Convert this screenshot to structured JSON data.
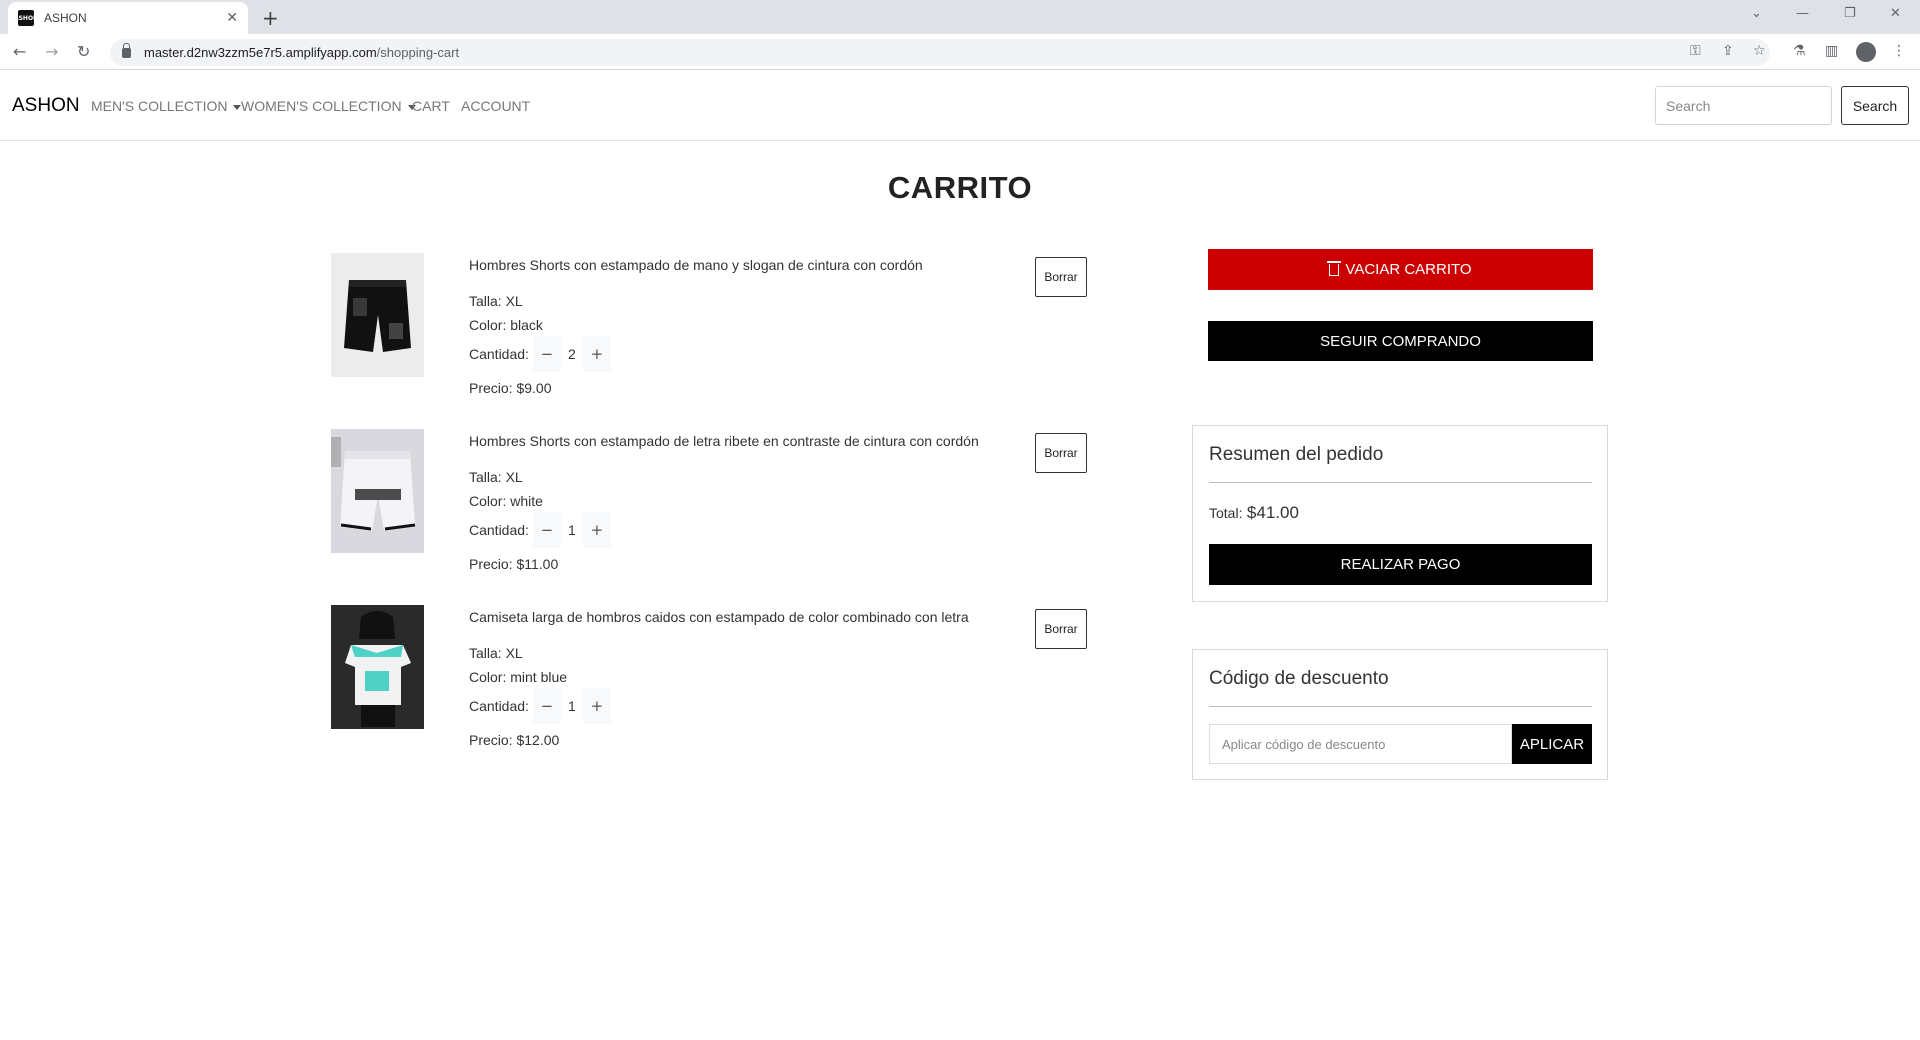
{
  "browser": {
    "tab_title": "ASHON",
    "favicon_text": "ASHON",
    "url_host": "master.d2nw3zzm5e7r5.amplifyapp.com",
    "url_path": "/shopping-cart"
  },
  "navbar": {
    "brand": "ASHON",
    "links": [
      "MEN'S COLLECTION",
      "WOMEN'S COLLECTION",
      "CART",
      "ACCOUNT"
    ],
    "search_placeholder": "Search",
    "search_button": "Search"
  },
  "page": {
    "title": "CARRITO"
  },
  "cart": {
    "delete_label": "Borrar",
    "qty_label": "Cantidad:",
    "items": [
      {
        "name": "Hombres Shorts con estampado de mano y slogan de cintura con cordón",
        "size": "Talla: XL",
        "color": "Color: black",
        "qty": "2",
        "price": "Precio: $9.00"
      },
      {
        "name": "Hombres Shorts con estampado de letra ribete en contraste de cintura con cordón",
        "size": "Talla: XL",
        "color": "Color: white",
        "qty": "1",
        "price": "Precio: $11.00"
      },
      {
        "name": "Camiseta larga de hombros caidos con estampado de color combinado con letra",
        "size": "Talla: XL",
        "color": "Color: mint blue",
        "qty": "1",
        "price": "Precio: $12.00"
      }
    ]
  },
  "actions": {
    "empty_cart": "VACIAR CARRITO",
    "continue_shopping": "SEGUIR COMPRANDO"
  },
  "summary": {
    "title": "Resumen del pedido",
    "total_label": "Total:",
    "total_value": "$41.00",
    "pay_button": "REALIZAR PAGO"
  },
  "discount": {
    "title": "Código de descuento",
    "placeholder": "Aplicar código de descuento",
    "apply_button": "APLICAR"
  },
  "colors": {
    "danger": "#cc0000",
    "primary": "#000000"
  }
}
